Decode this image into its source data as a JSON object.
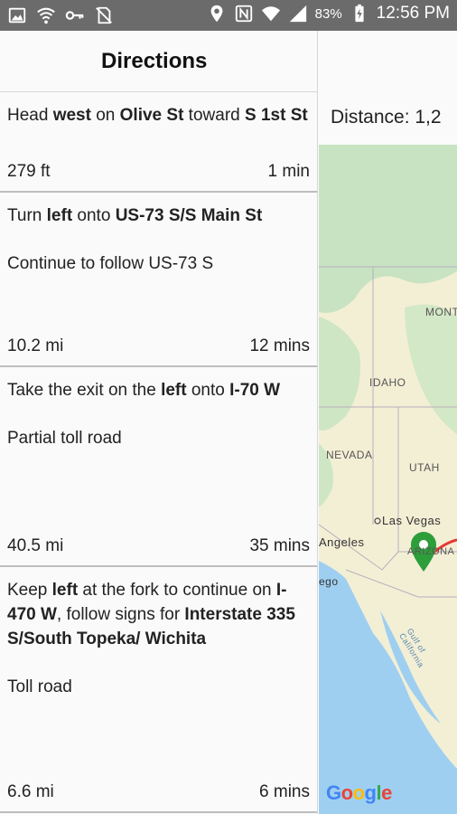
{
  "status_bar": {
    "battery_percent": "83%",
    "time": "12:56 PM",
    "left_icons": [
      "image-icon",
      "wifi-alert-icon",
      "key-icon",
      "no-sim-icon"
    ],
    "right_icons": [
      "location-icon",
      "nfc-icon",
      "wifi-icon",
      "signal-icon",
      "battery-charging-icon"
    ]
  },
  "header": {
    "title": "Directions"
  },
  "steps": [
    {
      "instruction_parts": [
        {
          "text": "Head ",
          "bold": false
        },
        {
          "text": "west",
          "bold": true
        },
        {
          "text": " on ",
          "bold": false
        },
        {
          "text": "Olive St",
          "bold": true
        },
        {
          "text": " toward ",
          "bold": false
        },
        {
          "text": "S 1st St",
          "bold": true
        }
      ],
      "note": "",
      "distance": "279 ft",
      "duration": "1 min"
    },
    {
      "instruction_parts": [
        {
          "text": "Turn ",
          "bold": false
        },
        {
          "text": "left",
          "bold": true
        },
        {
          "text": " onto ",
          "bold": false
        },
        {
          "text": "US-73 S/S Main St",
          "bold": true
        }
      ],
      "note": "Continue to follow US-73 S",
      "distance": "10.2 mi",
      "duration": "12 mins"
    },
    {
      "instruction_parts": [
        {
          "text": "Take the exit on the ",
          "bold": false
        },
        {
          "text": "left",
          "bold": true
        },
        {
          "text": " onto ",
          "bold": false
        },
        {
          "text": "I-70 W",
          "bold": true
        }
      ],
      "note": "Partial toll road",
      "distance": "40.5 mi",
      "duration": "35 mins"
    },
    {
      "instruction_parts": [
        {
          "text": "Keep ",
          "bold": false
        },
        {
          "text": "left",
          "bold": true
        },
        {
          "text": " at the fork to continue on ",
          "bold": false
        },
        {
          "text": "I-470 W",
          "bold": true
        },
        {
          "text": ", follow signs for ",
          "bold": false
        },
        {
          "text": "Interstate 335 S/South Topeka/ Wichita",
          "bold": true
        }
      ],
      "note": "Toll road",
      "distance": "6.6 mi",
      "duration": "6 mins"
    }
  ],
  "distance_label": "Distance: 1,2",
  "map": {
    "labels": {
      "mont": "MONT",
      "idaho": "IDAHO",
      "nevada": "NEVADA",
      "utah": "UTAH",
      "las_vegas": "Las Vegas",
      "angeles": "Angeles",
      "arizona": "ARIZONA",
      "ego": "ego",
      "gulf": "Gulf of California"
    },
    "google_logo": [
      "G",
      "o",
      "o",
      "g",
      "l",
      "e"
    ],
    "colors": {
      "water": "#9fcff0",
      "land": "#f3efd5",
      "forest": "#c8e3c2",
      "route": "#e53935",
      "marker": "#2e9e3a"
    }
  }
}
